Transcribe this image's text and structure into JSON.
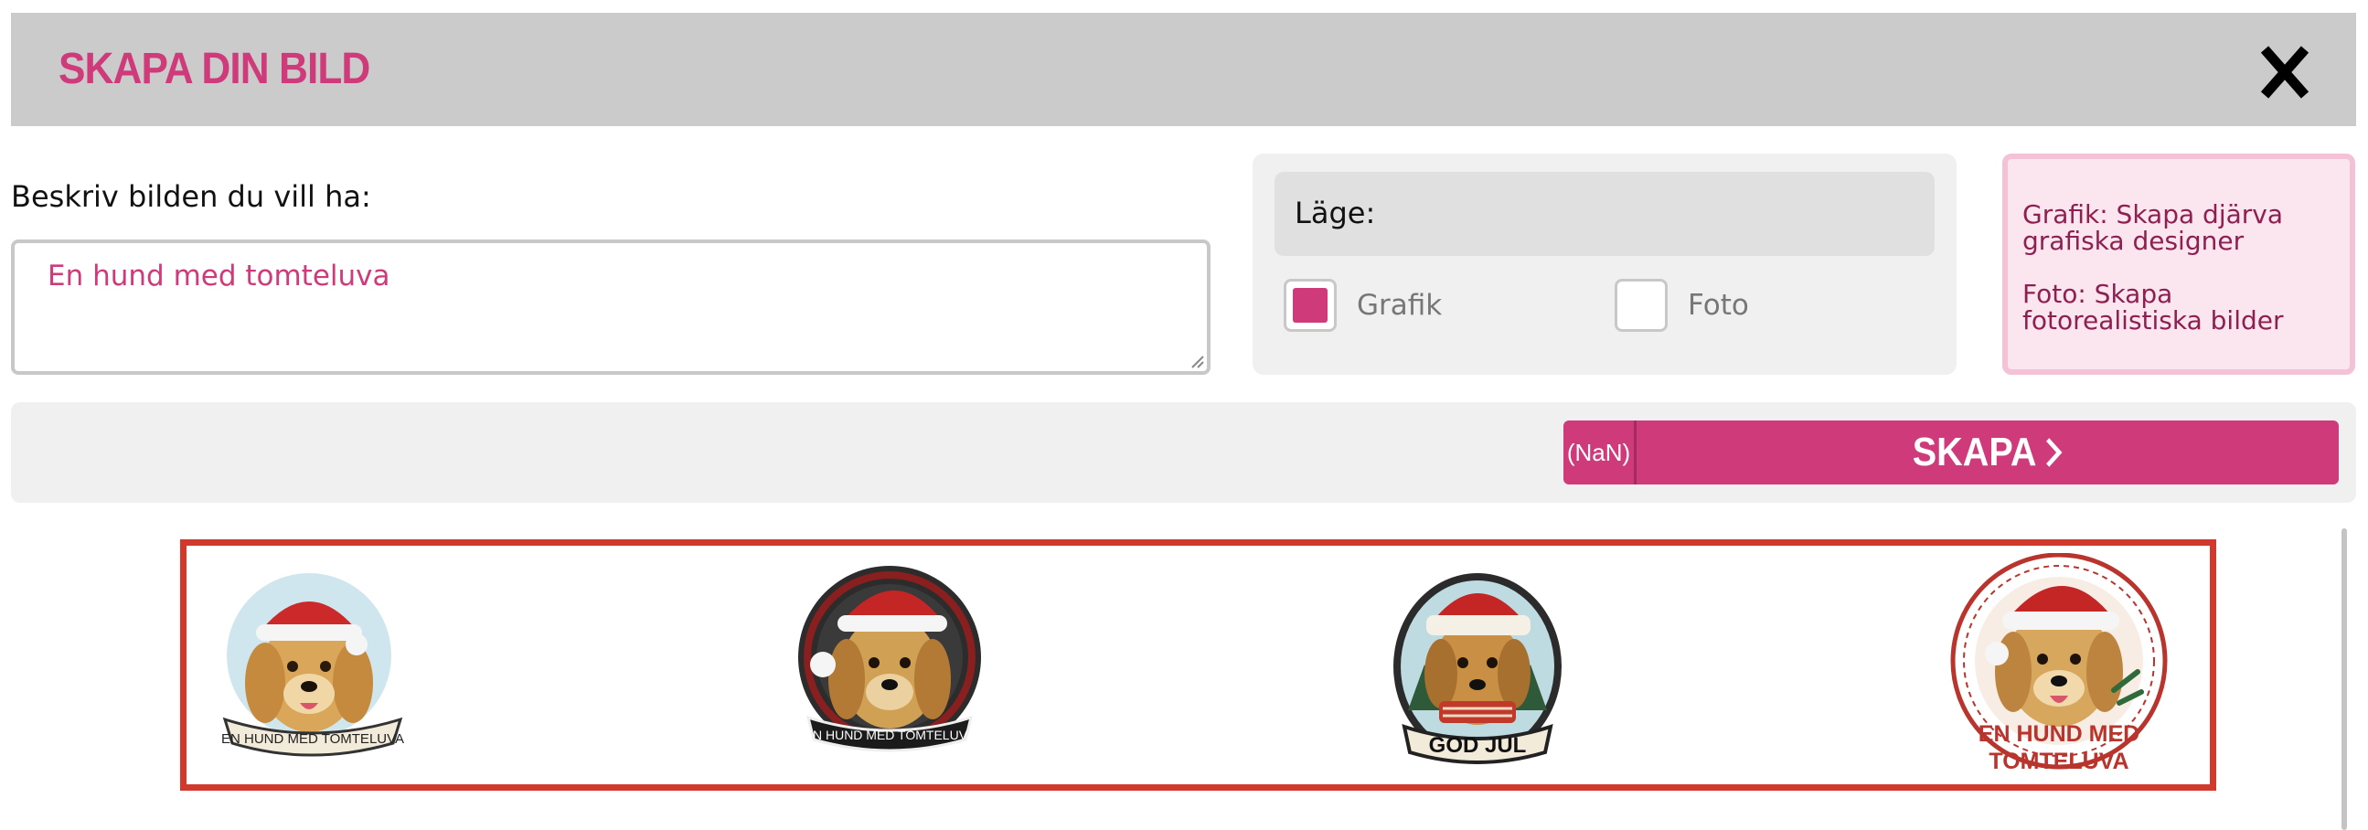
{
  "header": {
    "title": "SKAPA DIN BILD",
    "close_label": "X"
  },
  "prompt": {
    "label": "Beskriv bilden du vill ha:",
    "value": "En hund med tomteluva"
  },
  "mode": {
    "label": "Läge:",
    "options": [
      {
        "label": "Grafik",
        "checked": true
      },
      {
        "label": "Foto",
        "checked": false
      }
    ]
  },
  "info": {
    "grafik_text": "Grafik: Skapa djärva grafiska designer",
    "foto_text": "Foto: Skapa fotorealistiska bilder"
  },
  "action": {
    "cost_label": "(NaN)",
    "create_label": "SKAPA"
  },
  "gallery": {
    "items": [
      {
        "icon": "golden-retriever-santa-hat-sticker",
        "caption": "EN HUND MED TOMTELUVA"
      },
      {
        "icon": "golden-retriever-santa-hat-sticker",
        "caption": "EN HUND MED TOMTELUVA"
      },
      {
        "icon": "golden-retriever-santa-hat-scarf-sticker",
        "caption": "GOD JUL"
      },
      {
        "icon": "golden-retriever-santa-hat-sticker",
        "caption": "EN HUND MED TOMTELUVA"
      }
    ]
  },
  "colors": {
    "accent": "#cf3a7a",
    "header_bg": "#cbcbcb",
    "panel_bg": "#f0f0f0",
    "gallery_border": "#d0392b",
    "info_bg": "#fbe6ef",
    "info_text": "#8e1f51"
  }
}
